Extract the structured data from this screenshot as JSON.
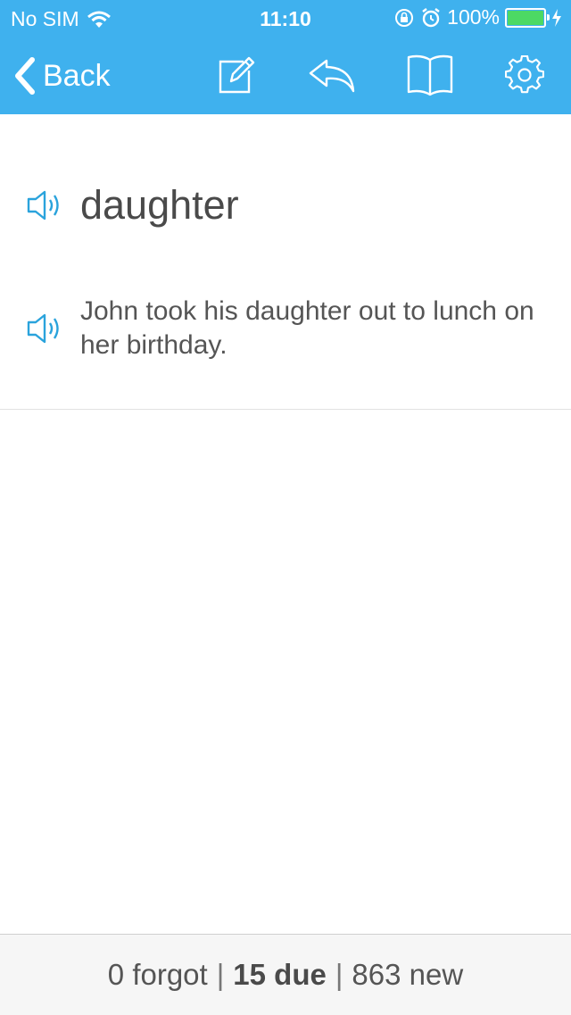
{
  "status_bar": {
    "carrier": "No SIM",
    "time": "11:10",
    "battery_percent": "100%",
    "battery_level": 1.0,
    "icons": [
      "wifi-icon",
      "rotation-lock-icon",
      "alarm-icon",
      "battery-icon",
      "charging-icon"
    ]
  },
  "nav": {
    "back_label": "Back",
    "accent_color": "#3fb1ee",
    "actions": [
      "edit-icon",
      "reply-icon",
      "book-icon",
      "settings-gear-icon"
    ]
  },
  "card": {
    "word": "daughter",
    "sentence": "John took his daughter out to lunch on her birthday.",
    "speaker_color": "#2aa3dc"
  },
  "footer": {
    "forgot": "0 forgot",
    "separator": "|",
    "due": "15 due",
    "new": "863 new"
  }
}
